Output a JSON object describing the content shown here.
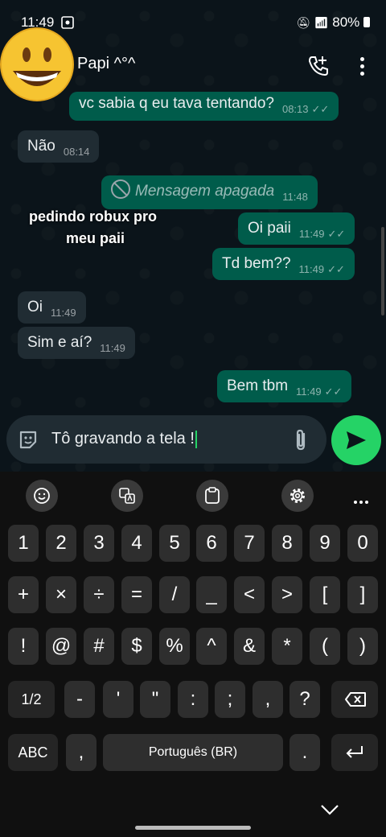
{
  "status": {
    "time": "11:49",
    "battery": "80%"
  },
  "header": {
    "contact_name": "Papi ^°^"
  },
  "messages": [
    {
      "text": "vc sabia q eu tava tentando?",
      "time": "08:13"
    },
    {
      "text": "Não",
      "time": "08:14"
    },
    {
      "text": "Mensagem apagada",
      "time": "11:48"
    },
    {
      "text": "Oi paii",
      "time": "11:49"
    },
    {
      "text": "Td bem??",
      "time": "11:49"
    },
    {
      "text": "Oi",
      "time": "11:49"
    },
    {
      "text": "Sim e aí?",
      "time": "11:49"
    },
    {
      "text": "Bem tbm",
      "time": "11:49"
    }
  ],
  "overlay": {
    "line1": "pedindo robux pro",
    "line2": "meu paii"
  },
  "composer": {
    "text": "Tô gravando a tela !"
  },
  "keyboard": {
    "row1": [
      "1",
      "2",
      "3",
      "4",
      "5",
      "6",
      "7",
      "8",
      "9",
      "0"
    ],
    "row2": [
      "+",
      "×",
      "÷",
      "=",
      "/",
      "_",
      "<",
      ">",
      "[",
      "]"
    ],
    "row3": [
      "!",
      "@",
      "#",
      "$",
      "%",
      "^",
      "&",
      "*",
      "(",
      ")"
    ],
    "row4": [
      "1/2",
      "-",
      "'",
      "\"",
      ":",
      ";",
      ",",
      "?"
    ],
    "abc": "ABC",
    "comma": ",",
    "space": "Português (BR)",
    "period": "."
  }
}
